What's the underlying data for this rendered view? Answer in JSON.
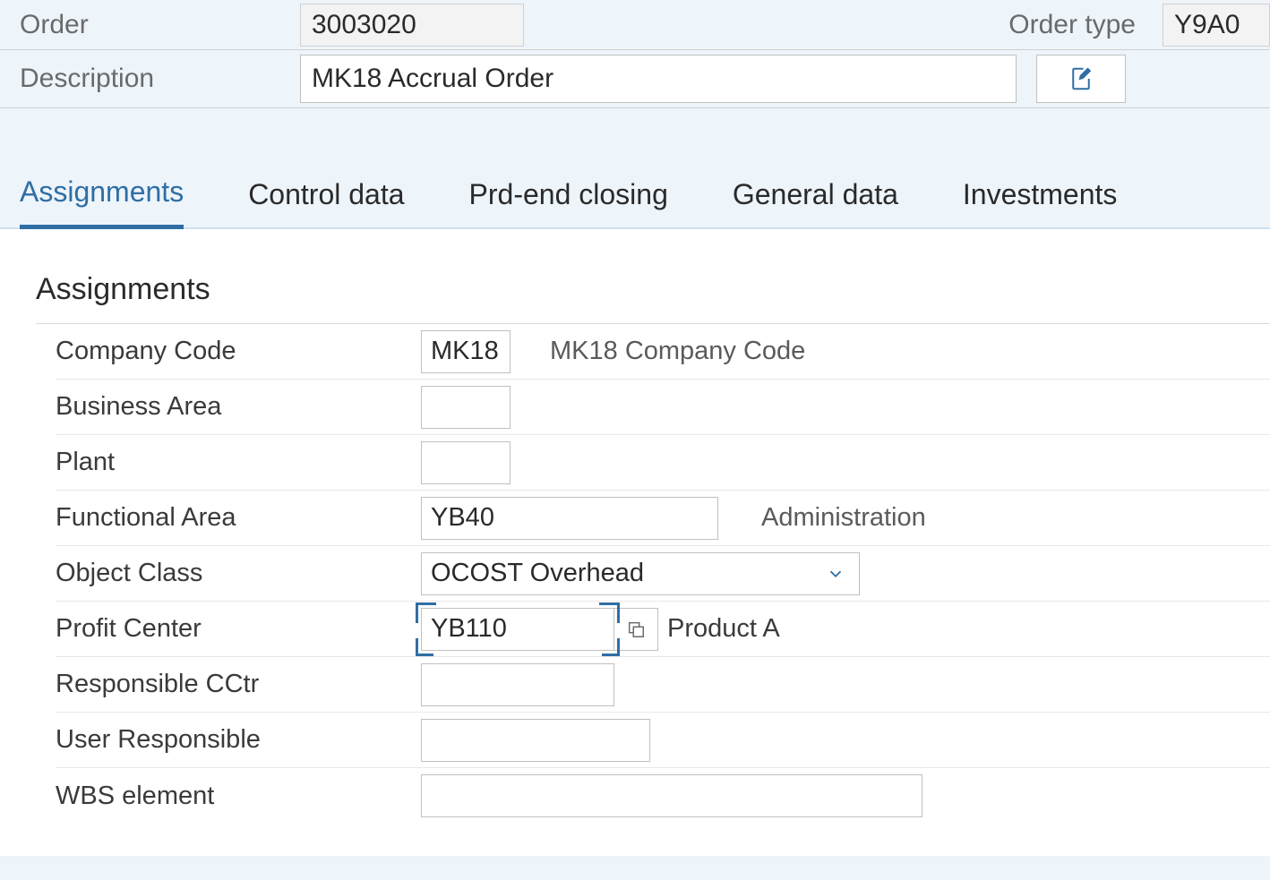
{
  "header": {
    "order_label": "Order",
    "order_value": "3003020",
    "order_type_label": "Order type",
    "order_type_value": "Y9A0",
    "description_label": "Description",
    "description_value": "MK18 Accrual Order"
  },
  "tabs": {
    "assignments": "Assignments",
    "control_data": "Control data",
    "prd_end": "Prd-end closing",
    "general_data": "General data",
    "investments": "Investments"
  },
  "assignments": {
    "section_title": "Assignments",
    "company_code": {
      "label": "Company Code",
      "value": "MK18",
      "desc": "MK18 Company Code"
    },
    "business_area": {
      "label": "Business Area",
      "value": ""
    },
    "plant": {
      "label": "Plant",
      "value": ""
    },
    "functional_area": {
      "label": "Functional Area",
      "value": "YB40",
      "desc": "Administration"
    },
    "object_class": {
      "label": "Object Class",
      "value": "OCOST Overhead"
    },
    "profit_center": {
      "label": "Profit Center",
      "value": "YB110",
      "desc": "Product A"
    },
    "responsible_cctr": {
      "label": "Responsible CCtr",
      "value": ""
    },
    "user_responsible": {
      "label": "User Responsible",
      "value": ""
    },
    "wbs_element": {
      "label": "WBS element",
      "value": ""
    }
  }
}
